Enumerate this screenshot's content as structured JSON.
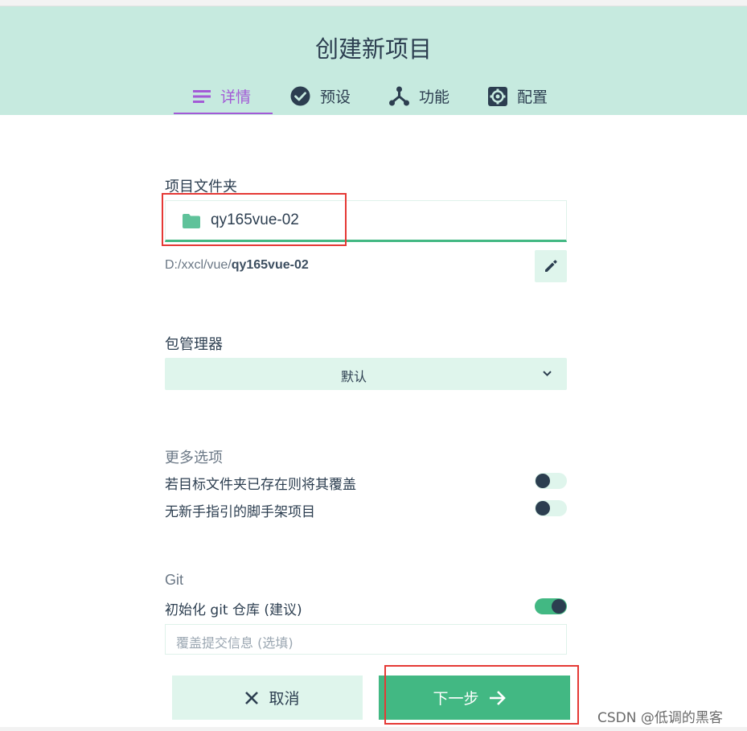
{
  "header": {
    "title": "创建新项目",
    "tabs": [
      {
        "label": "详情",
        "icon": "list-icon",
        "active": true
      },
      {
        "label": "预设",
        "icon": "check-circle-icon",
        "active": false
      },
      {
        "label": "功能",
        "icon": "feature-tree-icon",
        "active": false
      },
      {
        "label": "配置",
        "icon": "gear-icon",
        "active": false
      }
    ]
  },
  "project_folder": {
    "label": "项目文件夹",
    "value": "qy165vue-02",
    "path_prefix": "D:/xxcl/vue/",
    "path_name": "qy165vue-02"
  },
  "package_manager": {
    "label": "包管理器",
    "selected": "默认"
  },
  "more_options": {
    "label": "更多选项",
    "items": [
      {
        "label": "若目标文件夹已存在则将其覆盖",
        "enabled": false
      },
      {
        "label": "无新手指引的脚手架项目",
        "enabled": false
      }
    ]
  },
  "git": {
    "label": "Git",
    "init_label": "初始化 git 仓库 (建议)",
    "init_enabled": true,
    "commit_placeholder": "覆盖提交信息 (选填)"
  },
  "actions": {
    "cancel": "取消",
    "next": "下一步"
  },
  "watermark": "CSDN @低调的黑客",
  "colors": {
    "header_bg": "#c6eadf",
    "accent_green": "#42b883",
    "active_tab": "#a35ad6",
    "text_dark": "#2c3e50",
    "highlight_red": "#e53935"
  }
}
